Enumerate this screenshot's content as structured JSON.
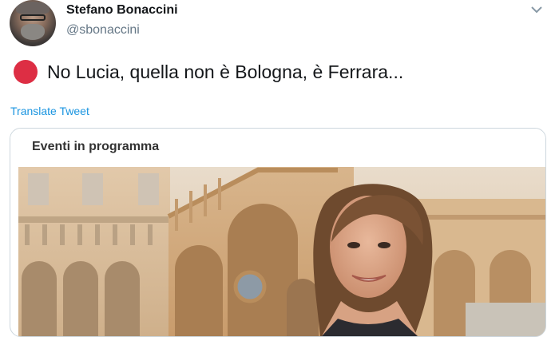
{
  "author": {
    "name": "Stefano Bonaccini",
    "handle": "@sbonaccini",
    "avatar_icon": "profile-avatar"
  },
  "tweet": {
    "emoji_icon": "red-circle",
    "text": "No Lucia, quella non è Bologna, è Ferrara...",
    "translate_label": "Translate Tweet"
  },
  "menu_icon": "chevron-down-icon",
  "media": {
    "header_title": "Eventi in programma",
    "photo_icon": "photo-building-woman"
  },
  "colors": {
    "emoji_red": "#dd2e44",
    "link_blue": "#1b95e0",
    "secondary_text": "#657786"
  }
}
